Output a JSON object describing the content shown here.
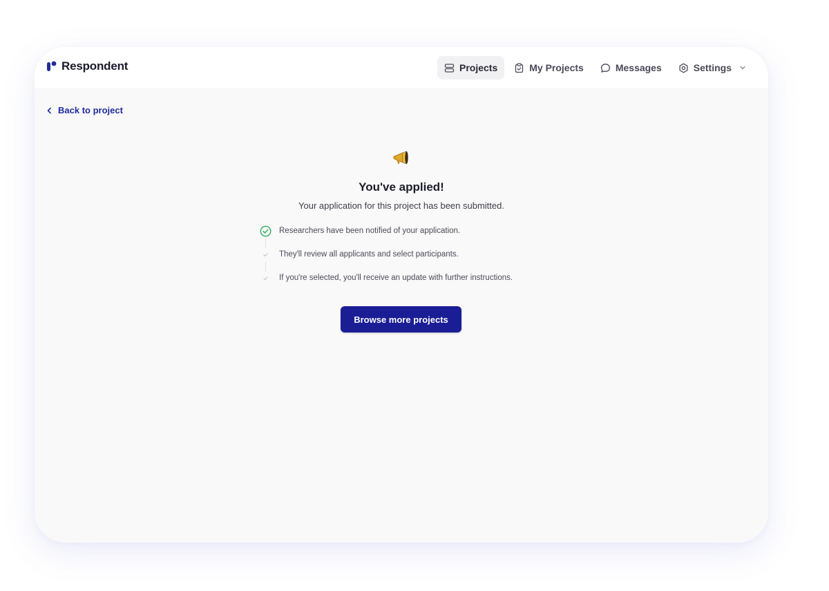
{
  "app": {
    "name": "Respondent",
    "brand_color": "#1f2c9a"
  },
  "nav": {
    "items": [
      {
        "label": "Projects",
        "icon": "projects-icon",
        "active": true
      },
      {
        "label": "My Projects",
        "icon": "clipboard-icon",
        "active": false
      },
      {
        "label": "Messages",
        "icon": "chat-bubble-icon",
        "active": false
      },
      {
        "label": "Settings",
        "icon": "gear-icon",
        "active": false
      }
    ]
  },
  "back_link": {
    "label": "Back to project"
  },
  "confirmation": {
    "icon": "megaphone-icon",
    "title": "You've applied!",
    "subtitle": "Your application for this project has been submitted.",
    "steps": [
      {
        "text": "Researchers have been notified of your application.",
        "status": "complete"
      },
      {
        "text": "They'll review all applicants and select participants.",
        "status": "pending"
      },
      {
        "text": "If you're selected, you'll receive an update with further instructions.",
        "status": "pending"
      }
    ],
    "cta_label": "Browse more projects",
    "cta_color": "#1a1d94",
    "success_color": "#2fae5a"
  }
}
